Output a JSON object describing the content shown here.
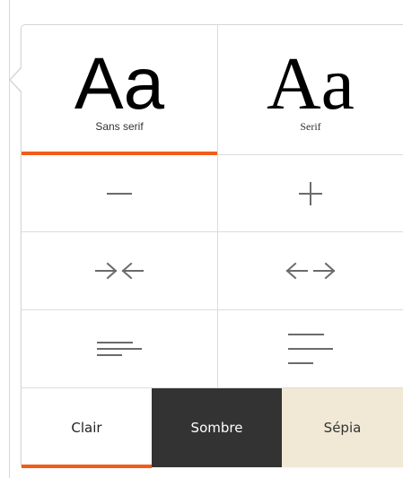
{
  "fonts": [
    {
      "sample": "Aa",
      "label": "Sans serif",
      "selected": true
    },
    {
      "sample": "Aa",
      "label": "Serif",
      "selected": false
    }
  ],
  "controls": {
    "decrease_size_icon": "minus-icon",
    "increase_size_icon": "plus-icon",
    "narrow_width_icon": "arrows-inward-icon",
    "widen_width_icon": "arrows-outward-icon",
    "tight_spacing_icon": "lines-tight-icon",
    "loose_spacing_icon": "lines-loose-icon"
  },
  "themes": [
    {
      "label": "Clair",
      "selected": true,
      "background": "#ffffff",
      "text_color": "#222222"
    },
    {
      "label": "Sombre",
      "selected": false,
      "background": "#333333",
      "text_color": "#ffffff"
    },
    {
      "label": "Sépia",
      "selected": false,
      "background": "#f1e8d6",
      "text_color": "#333333"
    }
  ],
  "colors": {
    "accent": "#f25c19",
    "icon": "#6b6b6b",
    "divider": "#dcdcdc"
  }
}
